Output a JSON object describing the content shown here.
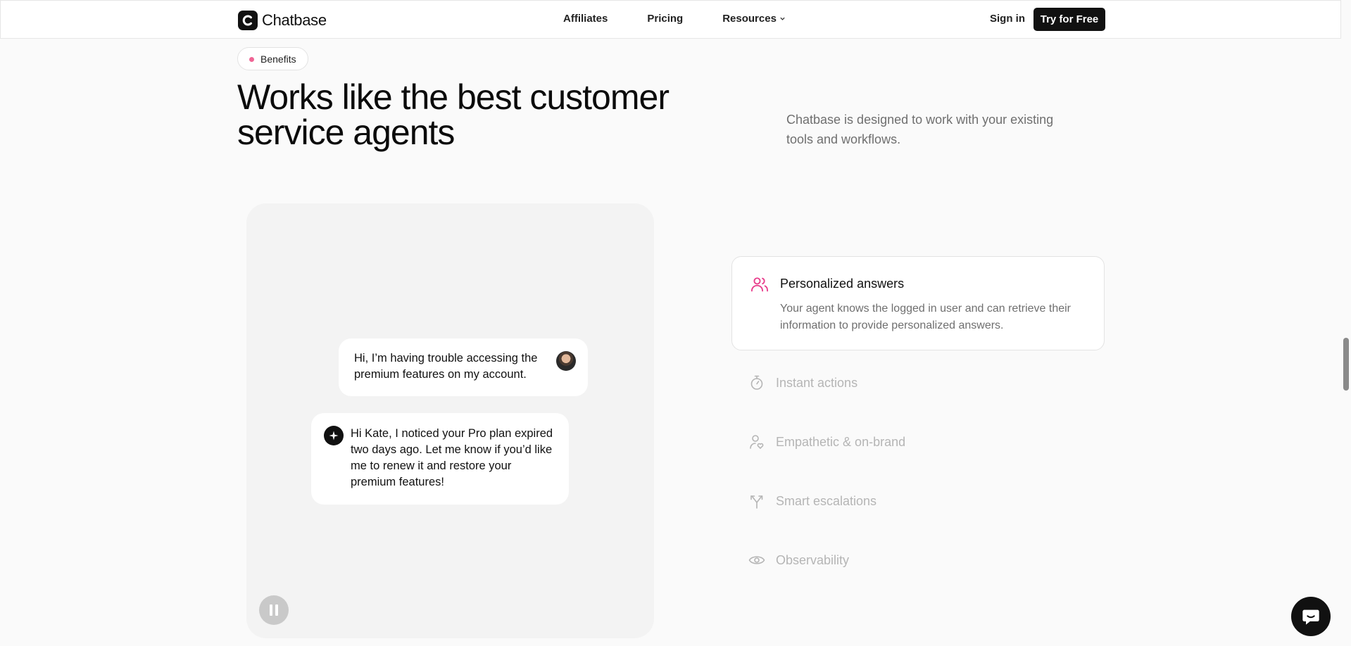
{
  "header": {
    "brand": "Chatbase",
    "nav": [
      {
        "label": "Affiliates"
      },
      {
        "label": "Pricing"
      },
      {
        "label": "Resources"
      }
    ],
    "signin_label": "Sign in",
    "cta_label": "Try for Free"
  },
  "hero": {
    "badge": "Benefits",
    "headline": "Works like the best customer service agents",
    "subtext": "Chatbase is designed to work with your existing tools and workflows."
  },
  "demo": {
    "user_message": "Hi, I’m having trouble accessing the premium features on my account.",
    "bot_message": "Hi Kate, I noticed your Pro plan expired two days ago. Let me know if you’d like me to renew it and restore your premium features!"
  },
  "features": {
    "active": {
      "title": "Personalized answers",
      "description": "Your agent knows the logged in user and can retrieve their information to provide personalized answers.",
      "icon": "users-icon"
    },
    "items": [
      {
        "title": "Instant actions",
        "icon": "stopwatch-icon"
      },
      {
        "title": "Empathetic & on-brand",
        "icon": "user-heart-icon"
      },
      {
        "title": "Smart escalations",
        "icon": "split-arrow-icon"
      },
      {
        "title": "Observability",
        "icon": "eye-icon"
      }
    ]
  },
  "colors": {
    "accent": "#e83e8c",
    "dark": "#111111",
    "muted": "#6f6f6f",
    "inactive": "#b5b5b5",
    "badge_dot": "#f06595"
  }
}
